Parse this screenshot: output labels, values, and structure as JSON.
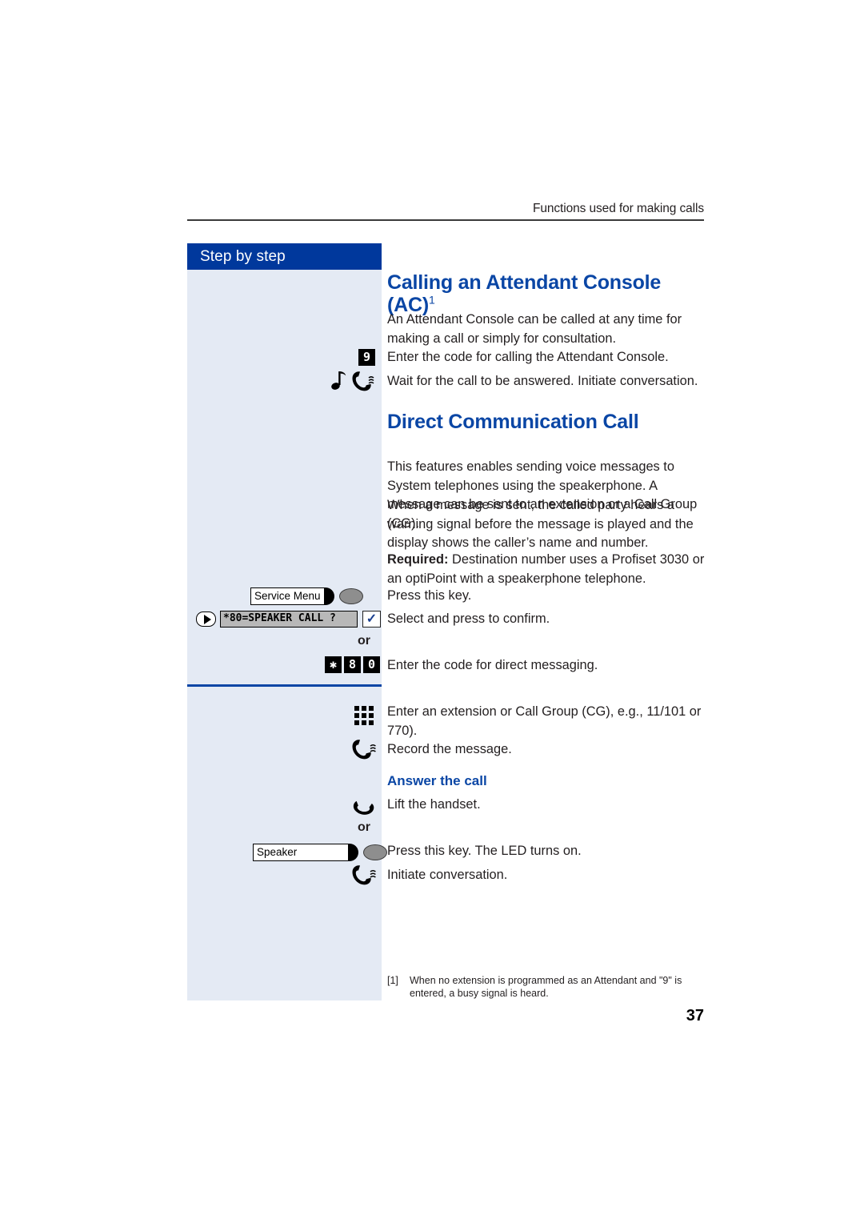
{
  "header": {
    "running_head": "Functions used for making calls"
  },
  "sidebar": {
    "title": "Step by step"
  },
  "section1": {
    "heading": "Calling an Attendant Console (AC)",
    "heading_footnote": "1",
    "intro": "An Attendant Console can be called at any time for making a call or simply for consultation.",
    "steps": [
      {
        "icon": "keycap-9",
        "key": "9",
        "text": "Enter the code for calling the Attendant Console."
      },
      {
        "icon": "ring-handset",
        "text": "Wait for the call to be answered. Initiate conversation."
      }
    ]
  },
  "section2": {
    "heading": "Direct Communication Call",
    "para1": "This features enables sending voice messages to System telephones using the speakerphone. A message can be sent to an extension or a Call Group (CG).",
    "para2": "When a message is sent, the called party hears a warning signal before the message is played and the display shows the caller’s name and number.",
    "para3_bold": "Required:",
    "para3": " Destination number uses a Profiset 3030 or an optiPoint with a speakerphone telephone.",
    "steps": [
      {
        "icon": "function-key",
        "key_label": "Service Menu",
        "text": "Press this key."
      },
      {
        "icon": "display-line",
        "display": "*80=SPEAKER CALL ?",
        "confirm": "✓",
        "text": "Select and press to confirm."
      },
      {
        "icon": "or",
        "text": "or"
      },
      {
        "icon": "keycaps",
        "keys": [
          "✱",
          "8",
          "0"
        ],
        "text": "Enter the code for direct messaging."
      },
      {
        "icon": "keypad",
        "text": "Enter an extension or Call Group (CG), e.g., 11/101 or 770)."
      },
      {
        "icon": "handset-waves",
        "text": "Record the message."
      }
    ],
    "subheading": "Answer the call",
    "answer_steps": [
      {
        "icon": "lift-handset",
        "text": "Lift the handset."
      },
      {
        "icon": "or",
        "text": "or"
      },
      {
        "icon": "function-key",
        "key_label": "Speaker",
        "text": "Press this key. The LED turns on."
      },
      {
        "icon": "handset-waves",
        "text": "Initiate conversation."
      }
    ]
  },
  "footnote": {
    "marker": "[1]",
    "text": "When no extension is programmed as an Attendant and \"9\" is entered, a busy signal is heard."
  },
  "folio": {
    "page_number": "37"
  },
  "colors": {
    "accent_blue": "#0a46a5",
    "header_blue": "#00389c",
    "sidebar_bg": "#e4eaf4",
    "body_text": "#231f20"
  }
}
